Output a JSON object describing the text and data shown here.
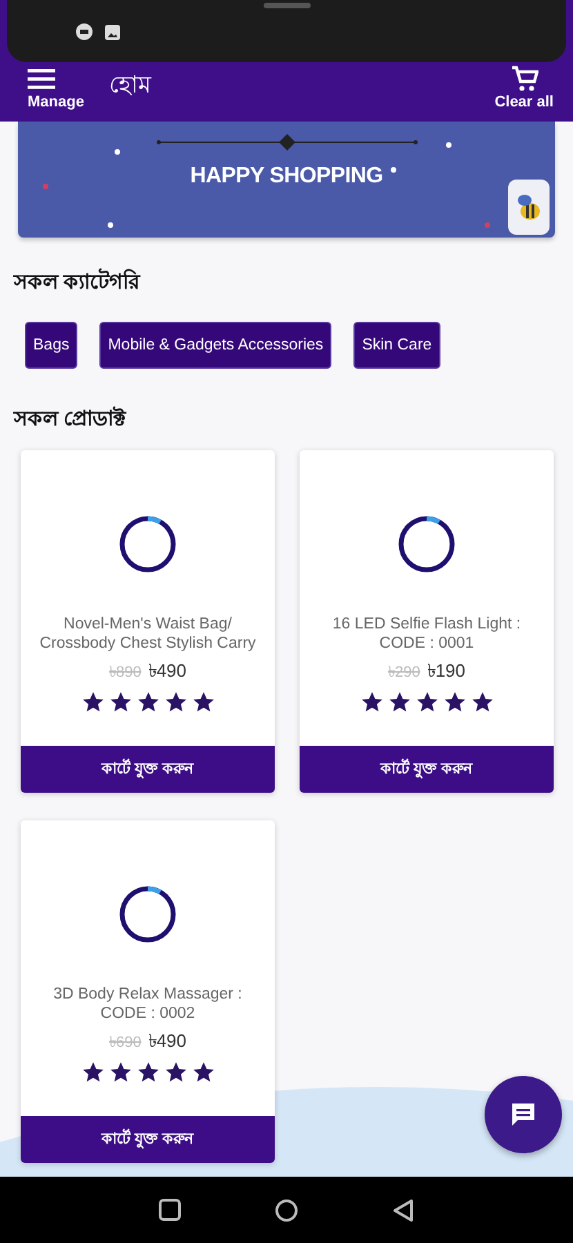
{
  "app_bar": {
    "title": "হোম",
    "menu_label": "Manage",
    "cart_label": "Clear all"
  },
  "banner": {
    "text": "HAPPY SHOPPING"
  },
  "categories_heading": "সকল ক্যাটেগরি",
  "categories": [
    {
      "label": "Bags"
    },
    {
      "label": "Mobile & Gadgets Accessories"
    },
    {
      "label": "Skin Care"
    }
  ],
  "products_heading": "সকল প্রোডাক্ট",
  "products": [
    {
      "name": "Novel-Men's Waist Bag/ Crossbody Chest Stylish Carry",
      "old_price": "৳890",
      "price": "৳490",
      "stars": 5,
      "button": "কার্টে যুক্ত করুন"
    },
    {
      "name": "16 LED Selfie Flash Light : CODE : 0001",
      "old_price": "৳290",
      "price": "৳190",
      "stars": 5,
      "button": "কার্টে যুক্ত করুন"
    },
    {
      "name": "3D Body Relax Massager : CODE : 0002",
      "old_price": "৳690",
      "price": "৳490",
      "stars": 5,
      "button": "কার্টে যুক্ত করুন"
    }
  ]
}
